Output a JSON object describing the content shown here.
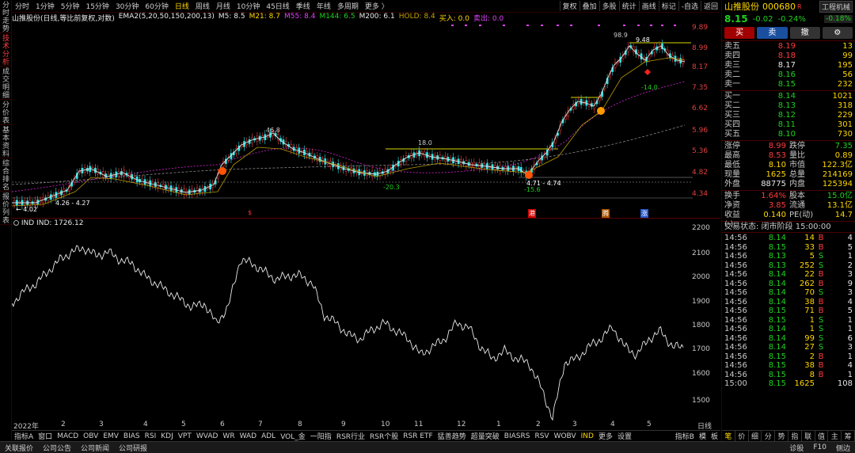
{
  "left_tabs": [
    "分时走势",
    "技术分析",
    "成交明细",
    "分价表",
    "基本资料",
    "综合排名",
    "报价列表"
  ],
  "timeframes": [
    "分时",
    "1分钟",
    "5分钟",
    "15分钟",
    "30分钟",
    "60分钟",
    "日线",
    "周线",
    "月线",
    "10分钟",
    "45日线",
    "季线",
    "年线",
    "多周期",
    "更多 〉"
  ],
  "active_timeframe": "日线",
  "right_tools": [
    "复权",
    "叠加",
    "多股",
    "统计",
    "画线",
    "标记",
    "-自选",
    "返回"
  ],
  "main_legend": {
    "name": "山推股份(日线,等比前复权,对数)",
    "ema_label": "EMA2(5,20,50,150,200,13)",
    "m5": "M5: 8.5",
    "m21": "M21: 8.7",
    "m55": "M55: 8.4",
    "m144": "M144: 6.5",
    "m200": "M200: 6.1",
    "hold": "HOLD: 8.4",
    "buy": "买入: 0.0",
    "sell": "卖出: 0.0"
  },
  "price_axis": [
    "9.89",
    "8.99",
    "8.17",
    "7.35",
    "6.62",
    "5.96",
    "5.36",
    "4.82",
    "4.34"
  ],
  "annotations": {
    "a98": "98.9",
    "a948": "9.48",
    "a140": "-14.0",
    "a468": "46.8",
    "a180": "18.0",
    "a203": "-20.3",
    "a156": "-15.6",
    "range1": "4.26 - 4.27",
    "range2": "4.71 - 4.74",
    "low": "← 4.02"
  },
  "events": {
    "e1": "$",
    "e2": "港",
    "e3": "腾",
    "e4": "涨"
  },
  "ind_legend": "IND  IND: 1726.12",
  "ind_axis": [
    "2200",
    "2100",
    "2000",
    "1900",
    "1800",
    "1700",
    "1600",
    "1500"
  ],
  "x_labels": [
    "2022年",
    "2",
    "3",
    "4",
    "5",
    "6",
    "7",
    "8",
    "9",
    "10",
    "11",
    "12",
    "1",
    "2",
    "3",
    "4",
    "5"
  ],
  "x_right": "日线",
  "bottom_tabs": [
    "指标A",
    "窗口",
    "MACD",
    "OBV",
    "EMV",
    "BIAS",
    "RSI",
    "KDJ",
    "VPT",
    "WVAD",
    "WR",
    "WAD",
    "ADL",
    "VOL_金",
    "一阳指",
    "RSR行业",
    "RSR个股",
    "RSR ETF",
    "猛善趋势",
    "超量突破",
    "BIASRS",
    "RSV",
    "WOBV",
    "IND",
    "更多",
    "设置"
  ],
  "active_bottom": "IND",
  "bottom_right": [
    "指标B",
    "模",
    "板"
  ],
  "status_bar": [
    "关联报价",
    "公司公告",
    "公司新闻",
    "公司研报"
  ],
  "status_right": [
    "诊股",
    "F10",
    "侧边"
  ],
  "stock": {
    "name": "山推股份",
    "code": "000680",
    "flag": "R",
    "sector": "工程机械",
    "price": "8.15",
    "change": "-0.02",
    "pct": "-0.24%",
    "sector_pct": "-0.18%"
  },
  "trade_buttons": [
    "买",
    "卖",
    "撤",
    "⚙"
  ],
  "asks": [
    {
      "label": "卖五",
      "price": "8.19",
      "vol": "13"
    },
    {
      "label": "卖四",
      "price": "8.18",
      "vol": "99"
    },
    {
      "label": "卖三",
      "price": "8.17",
      "vol": "195"
    },
    {
      "label": "卖二",
      "price": "8.16",
      "vol": "56"
    },
    {
      "label": "卖一",
      "price": "8.15",
      "vol": "232"
    }
  ],
  "bids": [
    {
      "label": "买一",
      "price": "8.14",
      "vol": "1021"
    },
    {
      "label": "买二",
      "price": "8.13",
      "vol": "318"
    },
    {
      "label": "买三",
      "price": "8.12",
      "vol": "229"
    },
    {
      "label": "买四",
      "price": "8.11",
      "vol": "301"
    },
    {
      "label": "买五",
      "price": "8.10",
      "vol": "730"
    }
  ],
  "quote": [
    [
      "涨停",
      "8.99",
      "跌停",
      "7.35"
    ],
    [
      "最高",
      "8.53",
      "量比",
      "0.89"
    ],
    [
      "最低",
      "8.10",
      "市值",
      "122.3亿"
    ],
    [
      "现量",
      "1625",
      "总量",
      "214169"
    ],
    [
      "外盘",
      "88775",
      "内盘",
      "125394"
    ]
  ],
  "fundamentals": [
    [
      "换手",
      "1.64%",
      "股本",
      "15.0亿"
    ],
    [
      "净资",
      "3.85",
      "流通",
      "13.1亿"
    ],
    [
      "收益(-)",
      "0.140",
      "PE(动)",
      "14.7"
    ]
  ],
  "trade_status": "交易状态: 闭市阶段 15:00:00",
  "ticks": [
    [
      "14:56",
      "8.14",
      "14",
      "B",
      "4"
    ],
    [
      "14:56",
      "8.15",
      "33",
      "B",
      "5"
    ],
    [
      "14:56",
      "8.13",
      "5",
      "S",
      "1"
    ],
    [
      "14:56",
      "8.13",
      "252",
      "S",
      "2"
    ],
    [
      "14:56",
      "8.14",
      "22",
      "B",
      "3"
    ],
    [
      "14:56",
      "8.14",
      "262",
      "B",
      "9"
    ],
    [
      "14:56",
      "8.14",
      "70",
      "S",
      "3"
    ],
    [
      "14:56",
      "8.14",
      "38",
      "B",
      "4"
    ],
    [
      "14:56",
      "8.15",
      "71",
      "B",
      "5"
    ],
    [
      "14:56",
      "8.15",
      "1",
      "S",
      "1"
    ],
    [
      "14:56",
      "8.14",
      "1",
      "S",
      "1"
    ],
    [
      "14:56",
      "8.14",
      "99",
      "S",
      "6"
    ],
    [
      "14:56",
      "8.14",
      "27",
      "S",
      "3"
    ],
    [
      "14:56",
      "8.15",
      "2",
      "B",
      "1"
    ],
    [
      "14:56",
      "8.15",
      "38",
      "B",
      "4"
    ],
    [
      "14:56",
      "8.15",
      "8",
      "B",
      "1"
    ],
    [
      "15:00",
      "8.15",
      "1625",
      "",
      "108"
    ]
  ],
  "rp_bottom_tabs": [
    "笔",
    "价",
    "细",
    "分",
    "势",
    "指",
    "联",
    "值",
    "主",
    "筹"
  ]
}
